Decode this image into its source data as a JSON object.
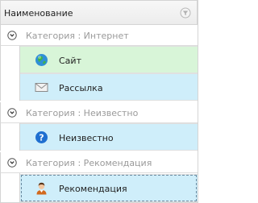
{
  "header": {
    "column_title": "Наименование",
    "filter_icon": "filter-icon"
  },
  "groups": [
    {
      "label": "Категория : Интернет",
      "rows": [
        {
          "label": "Сайт",
          "icon": "globe-icon",
          "color": "#d8f5d8"
        },
        {
          "label": "Рассылка",
          "icon": "envelope-icon",
          "color": "#cfeefa"
        }
      ]
    },
    {
      "label": "Категория : Неизвестно",
      "rows": [
        {
          "label": "Неизвестно",
          "icon": "question-icon",
          "color": "#cfeefa"
        }
      ]
    },
    {
      "label": "Категория : Рекомендация",
      "rows": [
        {
          "label": "Рекомендация",
          "icon": "person-icon",
          "color": "#cfeefa",
          "selected": true
        }
      ]
    }
  ]
}
